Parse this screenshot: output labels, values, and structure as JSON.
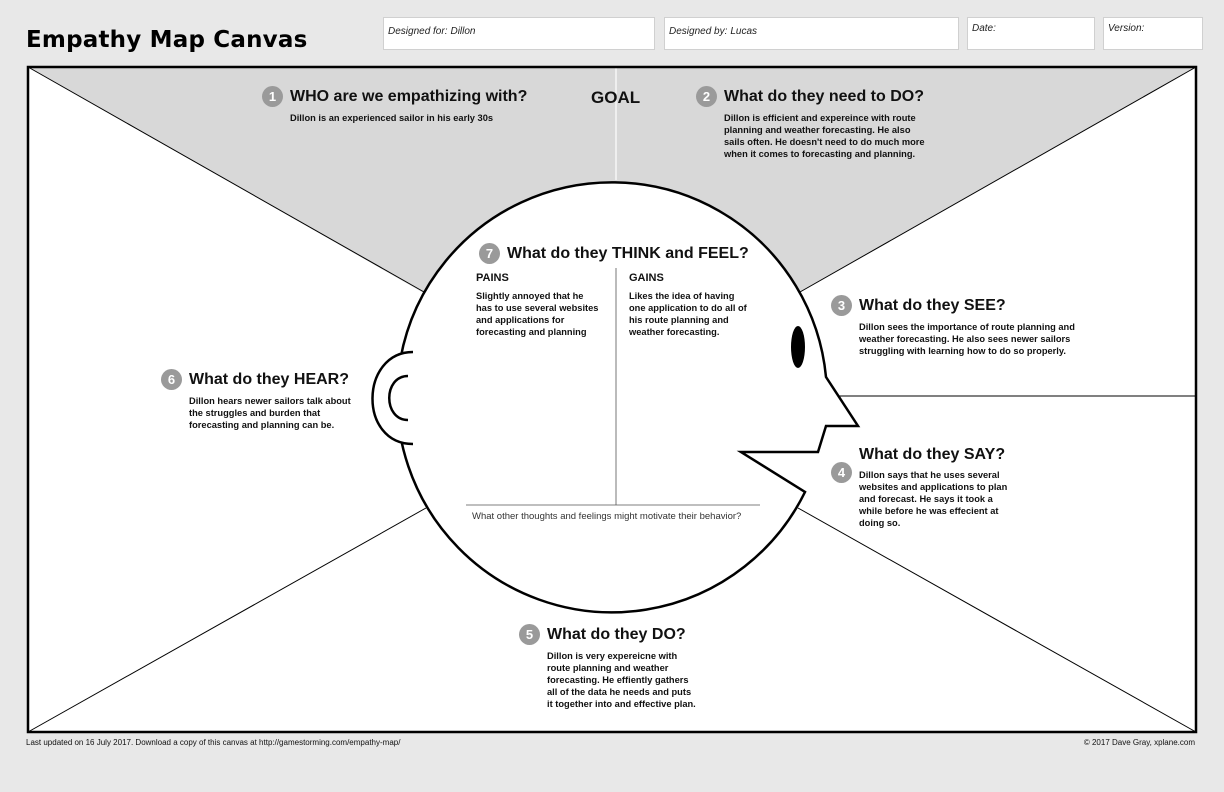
{
  "header": {
    "title": "Empathy Map Canvas",
    "designed_for": {
      "label": "Designed for:",
      "value": "Dillon"
    },
    "designed_by": {
      "label": "Designed by:",
      "value": "Lucas"
    },
    "date": {
      "label": "Date:",
      "value": ""
    },
    "version": {
      "label": "Version:",
      "value": ""
    }
  },
  "canvas": {
    "goal_label": "GOAL",
    "who": {
      "number": "1",
      "heading": "WHO are we empathizing with?",
      "text": "Dillon is an experienced sailor in his early 30s"
    },
    "need_to_do": {
      "number": "2",
      "heading": "What do they need to DO?",
      "text": "Dillon is efficient and expereince with route planning and weather forecasting. He also sails often. He doesn't need to do much more when it comes to forecasting and planning."
    },
    "see": {
      "number": "3",
      "heading": "What do they SEE?",
      "text": "Dillon sees the importance of route planning and weather forecasting. He also sees newer sailors struggling with learning how to do so properly."
    },
    "say": {
      "number": "4",
      "heading": "What do they SAY?",
      "text": "Dillon says that he uses several websites and applications to plan and forecast. He says it took a while before he was effecient at doing so."
    },
    "do": {
      "number": "5",
      "heading": "What do they DO?",
      "text": "Dillon is very expereicne with route planning and weather forecasting. He effiently gathers all of the data he needs and puts it together into and effective plan."
    },
    "hear": {
      "number": "6",
      "heading": "What do they HEAR?",
      "text": "Dillon hears newer sailors talk about the struggles and burden that forecasting and planning can be."
    },
    "think_feel": {
      "number": "7",
      "heading": "What do they THINK and FEEL?",
      "pains": {
        "label": "PAINS",
        "text": "Slightly annoyed that he has to use several websites and applications for forecasting and planning"
      },
      "gains": {
        "label": "GAINS",
        "text": "Likes the idea of having one application to do all of his route planning and weather forecasting."
      },
      "prompt": "What other thoughts and feelings might motivate their behavior?"
    }
  },
  "footer": {
    "left": "Last updated on 16 July 2017. Download a copy of this canvas at http://gamestorming.com/empathy-map/",
    "right": "© 2017 Dave Gray, xplane.com"
  },
  "colors": {
    "background": "#e8e8e8",
    "goal_zone": "#d8d8d8",
    "number_badge": "#9a9a9a",
    "line": "#000000"
  }
}
